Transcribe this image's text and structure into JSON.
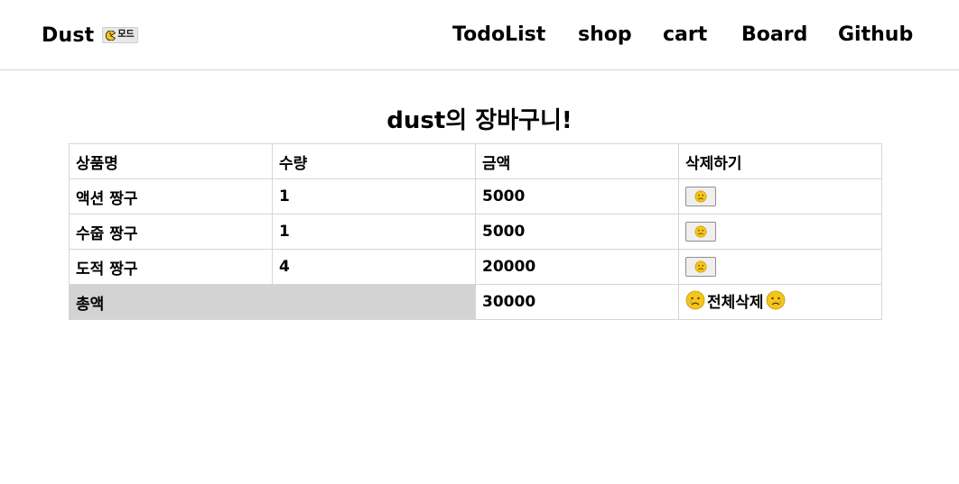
{
  "navbar": {
    "brand": "Dust",
    "mode_badge": "모드",
    "links": [
      "TodoList",
      "shop",
      "cart",
      "Board",
      "Github"
    ]
  },
  "cart": {
    "title": "dust의 장바구니!",
    "headers": [
      "상품명",
      "수량",
      "금액",
      "삭제하기"
    ],
    "rows": [
      {
        "name": "액션 짱구",
        "qty": "1",
        "price": "5000"
      },
      {
        "name": "수줍 짱구",
        "qty": "1",
        "price": "5000"
      },
      {
        "name": "도적 짱구",
        "qty": "4",
        "price": "20000"
      }
    ],
    "total_label": "총액",
    "total_value": "30000",
    "clear_all_label": "전체삭제"
  },
  "icons": {
    "pac_mode": "pacman-icon",
    "delete": "sad-face-icon",
    "clear_all": "crying-face-icon"
  },
  "colors": {
    "emoji_yellow": "#f5c518",
    "total_bg": "#d3d3d3",
    "border": "#d6d6d6"
  }
}
